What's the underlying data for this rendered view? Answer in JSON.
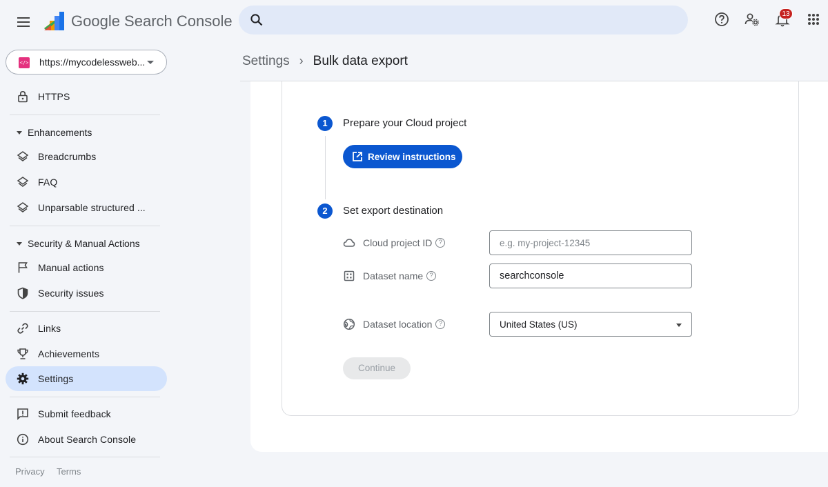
{
  "header": {
    "product_name": "Google Search Console",
    "search_placeholder": "",
    "notification_count": "13"
  },
  "sidebar": {
    "property": "https://mycodelessweb...",
    "property_favicon": "</>",
    "https_label": "HTTPS",
    "enhancements": {
      "title": "Enhancements",
      "items": [
        "Breadcrumbs",
        "FAQ",
        "Unparsable structured ..."
      ]
    },
    "security": {
      "title": "Security & Manual Actions",
      "items": [
        "Manual actions",
        "Security issues"
      ]
    },
    "links": "Links",
    "achievements": "Achievements",
    "settings": "Settings",
    "submit_feedback": "Submit feedback",
    "about": "About Search Console",
    "privacy": "Privacy",
    "terms": "Terms"
  },
  "breadcrumb": {
    "parent": "Settings",
    "current": "Bulk data export"
  },
  "step1": {
    "number": "1",
    "title": "Prepare your Cloud project",
    "button": "Review instructions"
  },
  "step2": {
    "number": "2",
    "title": "Set export destination",
    "project_label": "Cloud project ID",
    "project_placeholder": "e.g. my-project-12345",
    "dataset_label": "Dataset name",
    "dataset_value": "searchconsole",
    "location_label": "Dataset location",
    "location_value": "United States (US)",
    "continue": "Continue"
  },
  "colors": {
    "accent": "#0b57d0",
    "active_nav": "#d3e3fd",
    "search_bg": "#e1e9f8",
    "badge": "#c5221f"
  }
}
